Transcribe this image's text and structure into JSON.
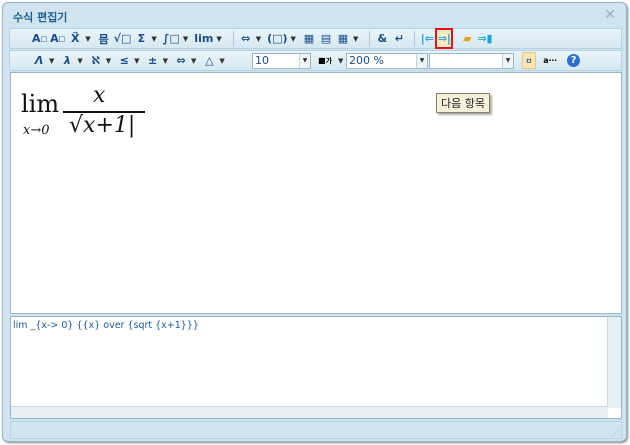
{
  "window": {
    "title": "수식 편집기",
    "close_icon": "close-icon"
  },
  "toolbar1": {
    "items": [
      "A²",
      "Aa",
      "X⃗",
      "▾",
      "믐",
      "√",
      "Σ",
      "∫",
      "lim",
      "⇔",
      "(□)",
      "▦",
      "▤",
      "▦",
      "&",
      "↵",
      "|⇐",
      "⇒|",
      "folder",
      "exit"
    ]
  },
  "toolbar2": {
    "font_size": "10",
    "zoom": "200 %",
    "font_name": "",
    "color_label": "가"
  },
  "tooltip": "다음 항목",
  "equation": {
    "lim": "lim",
    "sub": "x→0",
    "numerator": "x",
    "radicand": "x+1"
  },
  "source": "lim _{x-> 0} {{x} over {sqrt {x+1}}}",
  "accent": "#e0141e"
}
